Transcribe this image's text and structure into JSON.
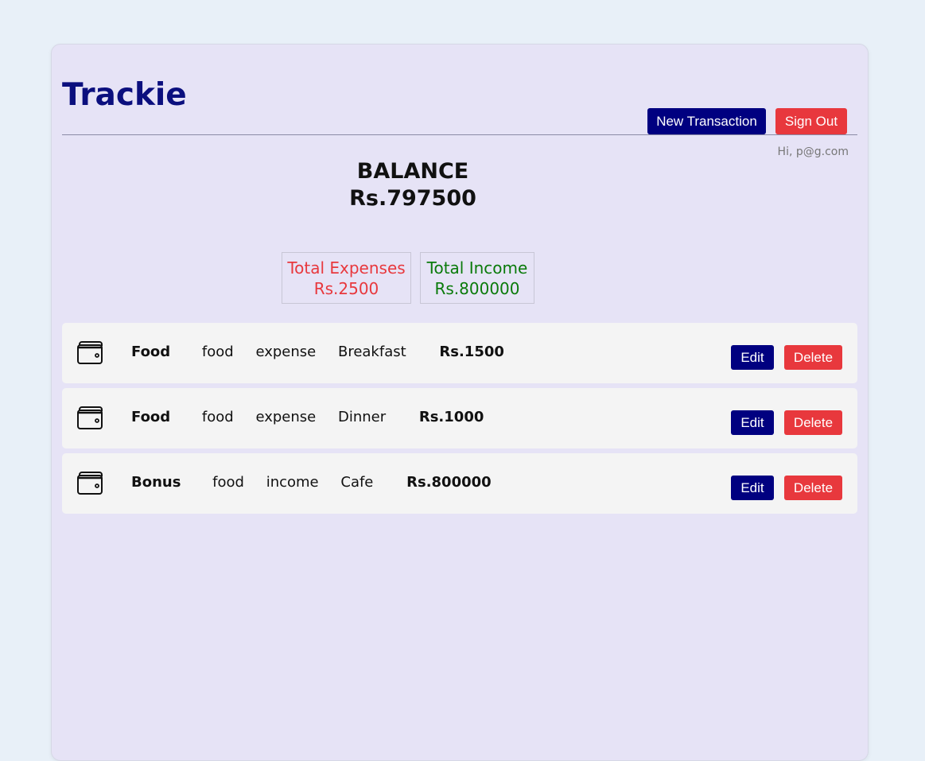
{
  "app": {
    "title": "Trackie"
  },
  "header": {
    "new_transaction_label": "New Transaction",
    "sign_out_label": "Sign Out",
    "greeting": "Hi, p@g.com"
  },
  "balance": {
    "label": "BALANCE",
    "value": "Rs.797500"
  },
  "totals": {
    "expenses_label": "Total Expenses",
    "expenses_value": "Rs.2500",
    "income_label": "Total Income",
    "income_value": "Rs.800000"
  },
  "transactions": [
    {
      "icon": "wallet-icon",
      "name": "Food",
      "category": "food",
      "type": "expense",
      "description": "Breakfast",
      "amount": "Rs.1500",
      "edit_label": "Edit",
      "delete_label": "Delete"
    },
    {
      "icon": "wallet-icon",
      "name": "Food",
      "category": "food",
      "type": "expense",
      "description": "Dinner",
      "amount": "Rs.1000",
      "edit_label": "Edit",
      "delete_label": "Delete"
    },
    {
      "icon": "wallet-icon",
      "name": "Bonus",
      "category": "food",
      "type": "income",
      "description": "Cafe",
      "amount": "Rs.800000",
      "edit_label": "Edit",
      "delete_label": "Delete"
    }
  ],
  "colors": {
    "brand": "#0b0f7e",
    "primary_button": "#000080",
    "danger_button": "#e8383d",
    "expense": "#e8383d",
    "income": "#0a7a0a",
    "card_background": "#e6e3f6",
    "page_background": "#e8f0f8",
    "row_background": "#f4f4f4"
  }
}
